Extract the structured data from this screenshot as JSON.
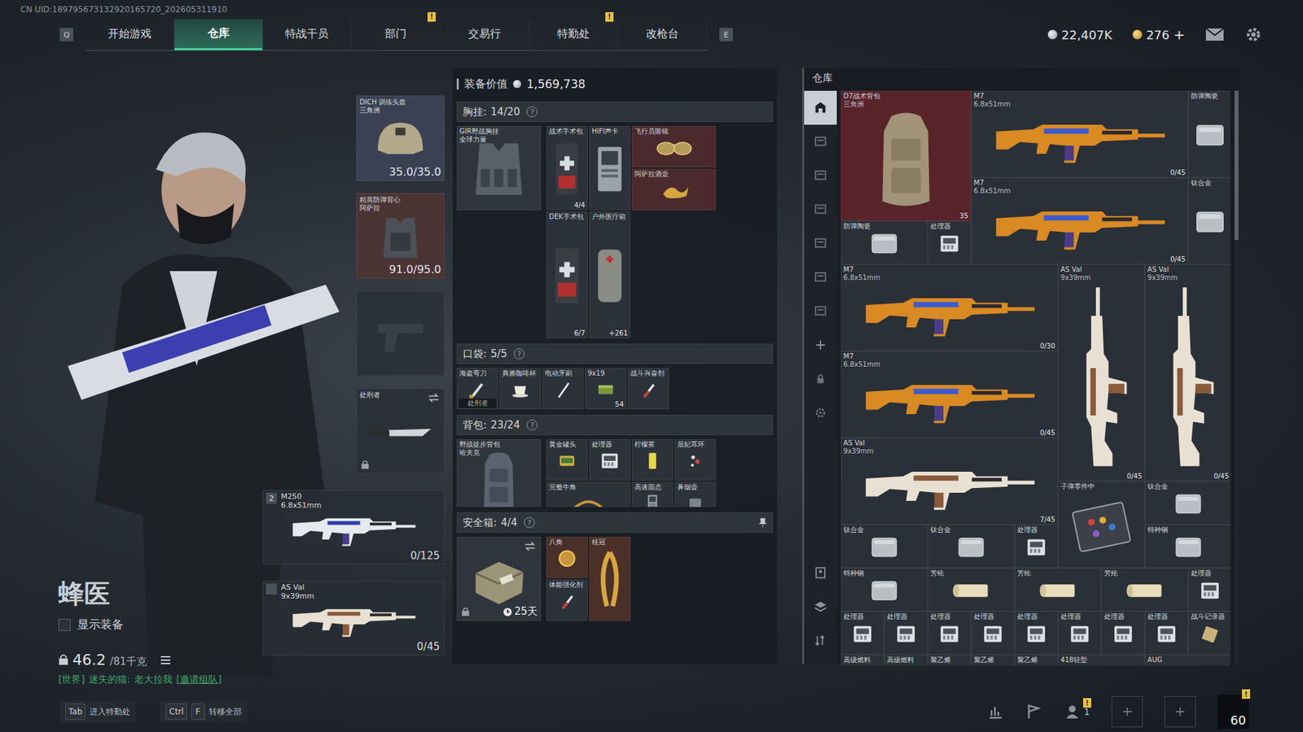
{
  "uid": "CN UID:189795673132920165720_202605311910",
  "nav": {
    "prev_key": "Q",
    "next_key": "E",
    "alert_mark": "!",
    "tabs": [
      {
        "label": "开始游戏",
        "selected": false,
        "alert": false
      },
      {
        "label": "仓库",
        "selected": true,
        "alert": false
      },
      {
        "label": "特战干员",
        "selected": false,
        "alert": false
      },
      {
        "label": "部门",
        "selected": false,
        "alert": true
      },
      {
        "label": "交易行",
        "selected": false,
        "alert": false
      },
      {
        "label": "特勤处",
        "selected": false,
        "alert": true
      },
      {
        "label": "改枪台",
        "selected": false,
        "alert": false
      }
    ]
  },
  "currency": [
    {
      "amount": "22,407K",
      "kind": "silver",
      "action": null
    },
    {
      "amount": "276",
      "kind": "gold",
      "action": "+"
    }
  ],
  "operator": {
    "name": "蜂医",
    "show_gear": {
      "label": "显示装备",
      "checked": false
    },
    "weight": "46.2",
    "capacity": "/81千克",
    "chat": {
      "channel": "[世界]",
      "sender": "迷失的猫:",
      "message": "老大拉我",
      "action": "[邀请组队]"
    }
  },
  "gear_slots": [
    {
      "kind": "helmet",
      "name": "DICH 训练头盔",
      "sub": "三角洲",
      "value": "35.0/35.0",
      "color": "#3a4152",
      "empty": false,
      "locked": false,
      "swappable": false
    },
    {
      "kind": "armor",
      "name": "精英防弹背心",
      "sub": "阿萨拉",
      "value": "91.0/95.0",
      "color": "#4b3434",
      "empty": false,
      "locked": false,
      "swappable": false
    },
    {
      "kind": "pistol",
      "color": "#262c33",
      "empty": true,
      "locked": false,
      "swappable": false
    },
    {
      "kind": "knife",
      "name": "处刑者",
      "color": "#2a3037",
      "empty": false,
      "locked": true,
      "swappable": true
    }
  ],
  "weapons": [
    {
      "name": "M250",
      "sub": "6.8x51mm",
      "ammo": "0/125",
      "index": "2",
      "kind": "lmg"
    },
    {
      "name": "AS Val",
      "sub": "9x39mm",
      "ammo": "0/45",
      "index": null,
      "kind": "rifle-val"
    }
  ],
  "loadout": {
    "title": "装备价值",
    "value": "1,569,738",
    "help_mark": "?",
    "sections": [
      {
        "kind": "rig",
        "title": "胸挂:",
        "count": "14/20",
        "pinned": false,
        "cols": 4,
        "rows": 5,
        "container": {
          "kind": "rig",
          "name": "GIR野战胸挂",
          "sub": "全球力量",
          "color": "#2f353c"
        },
        "items": [
          {
            "name": "战术手术包",
            "count": "4/4",
            "kind": "medkit",
            "col": 0,
            "row": 0,
            "w": 1,
            "h": 2,
            "color": "#2b3239"
          },
          {
            "name": "HIFI声卡",
            "kind": "device",
            "col": 1,
            "row": 0,
            "w": 1,
            "h": 2,
            "color": "#2b3239"
          },
          {
            "name": "飞行员眼镜",
            "kind": "glasses",
            "col": 2,
            "row": 0,
            "w": 2,
            "h": 1,
            "color": "#4a2a2d"
          },
          {
            "name": "阿萨拉酒壶",
            "kind": "gold",
            "col": 2,
            "row": 1,
            "w": 2,
            "h": 1,
            "color": "#4a2a2d"
          },
          {
            "name": "DEK手术包",
            "count": "6/7",
            "kind": "medkit",
            "col": 0,
            "row": 2,
            "w": 1,
            "h": 3,
            "color": "#2b3239"
          },
          {
            "name": "户外医疗箱",
            "count": "+261",
            "kind": "case",
            "col": 1,
            "row": 2,
            "w": 1,
            "h": 3,
            "color": "#2b3239"
          }
        ]
      },
      {
        "kind": "pocket",
        "title": "口袋:",
        "count": "5/5",
        "pinned": false,
        "cols": 5,
        "rows": 1,
        "container": null,
        "items": [
          {
            "name": "海盗弯刀",
            "tag": "处刑者",
            "kind": "blade",
            "col": 0,
            "row": 0,
            "w": 1,
            "h": 1,
            "color": "#2b3239"
          },
          {
            "name": "典雅咖啡杯",
            "kind": "cup",
            "col": 1,
            "row": 0,
            "w": 1,
            "h": 1,
            "color": "#2b3239"
          },
          {
            "name": "电动牙刷",
            "kind": "stick",
            "col": 2,
            "row": 0,
            "w": 1,
            "h": 1,
            "color": "#2b3239"
          },
          {
            "name": "9x19",
            "count": "54",
            "kind": "ammo",
            "col": 3,
            "row": 0,
            "w": 1,
            "h": 1,
            "color": "#2b3239"
          },
          {
            "name": "战斗兴奋剂",
            "kind": "syringe",
            "col": 4,
            "row": 0,
            "w": 1,
            "h": 1,
            "color": "#2b3239"
          }
        ]
      },
      {
        "kind": "backpack",
        "title": "背包:",
        "count": "23/24",
        "pinned": false,
        "cols": 4,
        "rows": 2,
        "container": {
          "kind": "backpack-bag",
          "name": "野战徒步背包",
          "sub": "哈夫克",
          "color": "#2f353c"
        },
        "items": [
          {
            "name": "黄金罐头",
            "kind": "tin",
            "col": 0,
            "row": 0,
            "w": 1,
            "h": 1,
            "color": "#2b3239"
          },
          {
            "name": "处理器",
            "kind": "chip",
            "col": 1,
            "row": 0,
            "w": 1,
            "h": 1,
            "color": "#2b3239"
          },
          {
            "name": "柠檬茶",
            "kind": "can",
            "col": 2,
            "row": 0,
            "w": 1,
            "h": 1,
            "color": "#2b3239"
          },
          {
            "name": "后妃耳环",
            "kind": "earring",
            "col": 3,
            "row": 0,
            "w": 1,
            "h": 1,
            "color": "#2b3239"
          },
          {
            "name": "完整牛角",
            "kind": "horn",
            "col": 0,
            "row": 1,
            "w": 2,
            "h": 1,
            "color": "#2b3239"
          },
          {
            "name": "高速固态",
            "kind": "ssd",
            "col": 2,
            "row": 1,
            "w": 1,
            "h": 1,
            "color": "#2b3239"
          },
          {
            "name": "鼻烟壶",
            "kind": "misc",
            "col": 3,
            "row": 1,
            "w": 1,
            "h": 1,
            "color": "#2b3239"
          }
        ]
      },
      {
        "kind": "safe",
        "title": "安全箱:",
        "count": "4/4",
        "pinned": true,
        "cols": 2,
        "rows": 2,
        "container": {
          "kind": "safe",
          "timer": "25天",
          "locked": true,
          "swappable": true,
          "color": "#2f353c"
        },
        "items": [
          {
            "name": "八角",
            "kind": "watch",
            "col": 0,
            "row": 0,
            "w": 1,
            "h": 1,
            "color": "#4a3028"
          },
          {
            "name": "桂冠",
            "kind": "wreath",
            "col": 1,
            "row": 0,
            "w": 1,
            "h": 2,
            "color": "#4a3028"
          },
          {
            "name": "体能强化剂",
            "kind": "syringe",
            "col": 0,
            "row": 1,
            "w": 1,
            "h": 1,
            "color": "#2b3239"
          }
        ]
      }
    ]
  },
  "stash": {
    "title": "仓库",
    "cols": 9,
    "sidebar_top": [
      {
        "kind": "home",
        "selected": true
      },
      {
        "kind": "page",
        "selected": false
      },
      {
        "kind": "page",
        "selected": false
      },
      {
        "kind": "page",
        "selected": false
      },
      {
        "kind": "page",
        "selected": false
      },
      {
        "kind": "page",
        "selected": false
      },
      {
        "kind": "page",
        "selected": false
      },
      {
        "kind": "plus",
        "selected": false
      },
      {
        "kind": "lock",
        "selected": false
      },
      {
        "kind": "gear",
        "selected": false
      }
    ],
    "sidebar_bottom": [
      {
        "kind": "card",
        "selected": false
      },
      {
        "kind": "layers",
        "selected": false
      },
      {
        "kind": "sort",
        "selected": false
      }
    ],
    "items": [
      {
        "name": "D7战术背包",
        "sub": "三角洲",
        "count": "35",
        "kind": "backpack",
        "col": 0,
        "row": 0,
        "w": 3,
        "h": 3,
        "color": "#58242a"
      },
      {
        "name": "M7",
        "sub": "6.8x51mm",
        "count": "0/45",
        "kind": "rifle",
        "col": 3,
        "row": 0,
        "w": 5,
        "h": 2,
        "color": "#2a3037"
      },
      {
        "name": "防弹陶瓷",
        "kind": "plate",
        "col": 8,
        "row": 0,
        "w": 1,
        "h": 2,
        "color": "#2a3037"
      },
      {
        "name": "M7",
        "sub": "6.8x51mm",
        "count": "0/45",
        "kind": "rifle",
        "col": 3,
        "row": 2,
        "w": 5,
        "h": 2,
        "color": "#2a3037"
      },
      {
        "name": "钛合金",
        "kind": "plate",
        "col": 8,
        "row": 2,
        "w": 1,
        "h": 2,
        "color": "#2a3037"
      },
      {
        "name": "防弹陶瓷",
        "kind": "plate",
        "col": 0,
        "row": 3,
        "w": 2,
        "h": 1,
        "color": "#2a3037"
      },
      {
        "name": "处理器",
        "kind": "chip",
        "col": 2,
        "row": 3,
        "w": 1,
        "h": 1,
        "color": "#2a3037"
      },
      {
        "name": "M7",
        "sub": "6.8x51mm",
        "count": "0/30",
        "kind": "rifle",
        "col": 0,
        "row": 4,
        "w": 5,
        "h": 2,
        "color": "#2a3037"
      },
      {
        "name": "AS Val",
        "sub": "9x39mm",
        "count": "0/45",
        "kind": "rifle-val-v",
        "col": 5,
        "row": 4,
        "w": 2,
        "h": 5,
        "color": "#2a3037"
      },
      {
        "name": "AS Val",
        "sub": "9x39mm",
        "count": "0/45",
        "kind": "rifle-val-v",
        "col": 7,
        "row": 4,
        "w": 2,
        "h": 5,
        "color": "#2a3037"
      },
      {
        "name": "M7",
        "sub": "6.8x51mm",
        "count": "0/45",
        "kind": "rifle",
        "col": 0,
        "row": 6,
        "w": 5,
        "h": 2,
        "color": "#2a3037"
      },
      {
        "name": "AS Val",
        "sub": "9x39mm",
        "count": "7/45",
        "kind": "rifle-val",
        "col": 0,
        "row": 8,
        "w": 5,
        "h": 2,
        "color": "#2a3037"
      },
      {
        "name": "子弹零件中",
        "kind": "parts",
        "col": 5,
        "row": 9,
        "w": 2,
        "h": 2,
        "color": "#2a3037"
      },
      {
        "name": "钛合金",
        "kind": "plate",
        "col": 7,
        "row": 9,
        "w": 2,
        "h": 1,
        "color": "#2a3037"
      },
      {
        "name": "钛合金",
        "kind": "plate",
        "col": 0,
        "row": 10,
        "w": 2,
        "h": 1,
        "color": "#2a3037"
      },
      {
        "name": "钛合金",
        "kind": "plate",
        "col": 2,
        "row": 10,
        "w": 2,
        "h": 1,
        "color": "#2a3037"
      },
      {
        "name": "处理器",
        "kind": "chip",
        "col": 4,
        "row": 10,
        "w": 1,
        "h": 1,
        "color": "#2a3037"
      },
      {
        "name": "特种钢",
        "kind": "plate",
        "col": 7,
        "row": 10,
        "w": 2,
        "h": 1,
        "color": "#2a3037"
      },
      {
        "name": "特种钢",
        "kind": "plate",
        "col": 0,
        "row": 11,
        "w": 2,
        "h": 1,
        "color": "#2a3037"
      },
      {
        "name": "芳纶",
        "kind": "roll",
        "col": 2,
        "row": 11,
        "w": 2,
        "h": 1,
        "color": "#2a3037"
      },
      {
        "name": "芳纶",
        "kind": "roll",
        "col": 4,
        "row": 11,
        "w": 2,
        "h": 1,
        "color": "#2a3037"
      },
      {
        "name": "芳纶",
        "kind": "roll",
        "col": 6,
        "row": 11,
        "w": 2,
        "h": 1,
        "color": "#2a3037"
      },
      {
        "name": "处理器",
        "kind": "chip",
        "col": 8,
        "row": 11,
        "w": 1,
        "h": 1,
        "color": "#2a3037"
      },
      {
        "name": "处理器",
        "kind": "chip",
        "col": 0,
        "row": 12,
        "w": 1,
        "h": 1,
        "color": "#2a3037"
      },
      {
        "name": "处理器",
        "kind": "chip",
        "col": 1,
        "row": 12,
        "w": 1,
        "h": 1,
        "color": "#2a3037"
      },
      {
        "name": "处理器",
        "kind": "chip",
        "col": 2,
        "row": 12,
        "w": 1,
        "h": 1,
        "color": "#2a3037"
      },
      {
        "name": "处理器",
        "kind": "chip",
        "col": 3,
        "row": 12,
        "w": 1,
        "h": 1,
        "color": "#2a3037"
      },
      {
        "name": "处理器",
        "kind": "chip",
        "col": 4,
        "row": 12,
        "w": 1,
        "h": 1,
        "color": "#2a3037"
      },
      {
        "name": "处理器",
        "kind": "chip",
        "col": 5,
        "row": 12,
        "w": 1,
        "h": 1,
        "color": "#2a3037"
      },
      {
        "name": "处理器",
        "kind": "chip",
        "col": 6,
        "row": 12,
        "w": 1,
        "h": 1,
        "color": "#2a3037"
      },
      {
        "name": "处理器",
        "kind": "chip",
        "col": 7,
        "row": 12,
        "w": 1,
        "h": 1,
        "color": "#2a3037"
      },
      {
        "name": "战斗记录器",
        "kind": "recorder",
        "col": 8,
        "row": 12,
        "w": 1,
        "h": 1,
        "color": "#2a3037"
      },
      {
        "name": "高级燃料",
        "kind": "misc",
        "col": 0,
        "row": 13,
        "w": 1,
        "h": 1,
        "color": "#2a3037"
      },
      {
        "name": "高级燃料",
        "kind": "misc",
        "col": 1,
        "row": 13,
        "w": 1,
        "h": 1,
        "color": "#2a3037"
      },
      {
        "name": "聚乙烯",
        "kind": "misc",
        "col": 2,
        "row": 13,
        "w": 1,
        "h": 1,
        "color": "#2a3037"
      },
      {
        "name": "聚乙烯",
        "kind": "misc",
        "col": 3,
        "row": 13,
        "w": 1,
        "h": 1,
        "color": "#2a3037"
      },
      {
        "name": "聚乙烯",
        "kind": "misc",
        "col": 4,
        "row": 13,
        "w": 1,
        "h": 1,
        "color": "#2a3037"
      },
      {
        "name": "418轻型",
        "kind": "misc",
        "col": 5,
        "row": 13,
        "w": 2,
        "h": 1,
        "color": "#2a3037"
      },
      {
        "name": "AUG",
        "kind": "misc",
        "col": 7,
        "row": 13,
        "w": 2,
        "h": 1,
        "color": "#2a3037"
      }
    ]
  },
  "footer": {
    "hints": [
      {
        "keys": [
          "Tab"
        ],
        "label": "进入特勤处"
      },
      {
        "keys": [
          "Ctrl",
          "F"
        ],
        "label": "转移全部"
      }
    ],
    "squad_count": "1",
    "level": "60"
  }
}
